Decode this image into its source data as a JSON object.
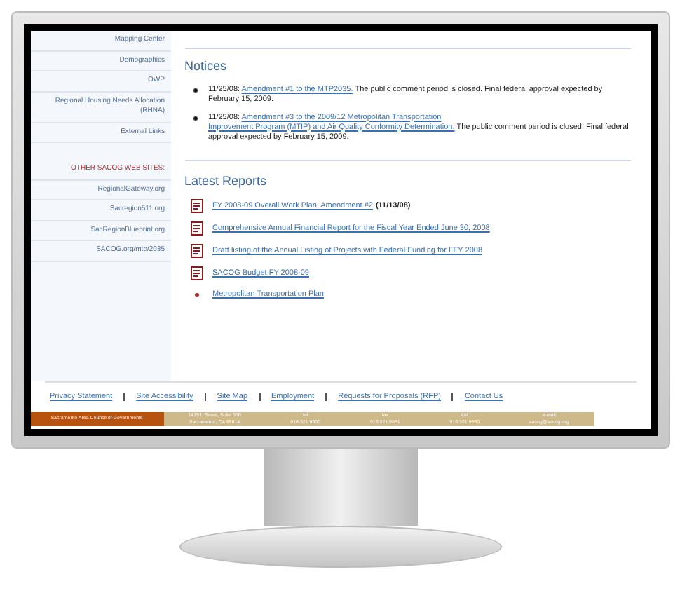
{
  "sidebar": {
    "links": [
      "Mapping Center",
      "Demographics",
      "OWP",
      "Regional Housing Needs Allocation (RHNA)",
      "External Links"
    ],
    "other_sites_heading": "OTHER SACOG WEB SITES:",
    "other_sites": [
      "RegionalGateway.org",
      "Sacregion511.org",
      "SacRegionBlueprint.org",
      "SACOG.org/mtp/2035"
    ]
  },
  "notices": {
    "title": "Notices",
    "items": [
      {
        "date": "11/25/08:",
        "link": "Amendment #1 to the MTP2035.",
        "text": "The public comment period is closed. Final federal approval expected by February 15, 2009."
      },
      {
        "date": "11/25/08:",
        "link_lines": [
          "Amendment #3 to the 2009/12 Metropolitan Transportation",
          "Improvement Program (MTIP) and Air Quality Conformity Determination."
        ],
        "text": "The public comment period is closed. Final federal approval expected by February 15, 2009."
      }
    ]
  },
  "latest_reports": {
    "title": "Latest Reports",
    "items": [
      {
        "kind": "pdf",
        "link": "FY 2008-09 Overall Work Plan, Amendment #2",
        "note": "(11/13/08)"
      },
      {
        "kind": "pdf",
        "link": "Comprehensive Annual Financial Report for the Fiscal Year Ended June 30, 2008"
      },
      {
        "kind": "pdf",
        "link": "Draft listing of the Annual Listing of Projects with Federal Funding for FFY 2008"
      },
      {
        "kind": "pdf",
        "link": "SACOG Budget FY 2008-09"
      },
      {
        "kind": "bullet",
        "link": "Metropolitan Transportation Plan"
      }
    ]
  },
  "footer_links": [
    "Privacy Statement",
    "Site Accessibility",
    "Site Map",
    "Employment",
    "Requests for Proposals (RFP)",
    "Contact Us"
  ],
  "footer_band": {
    "organization": "Sacramento Area Council of Governments",
    "contacts": [
      {
        "label": "1415 L Street, Suite 300",
        "value": "Sacramento, CA 95814"
      },
      {
        "label": "tel",
        "value": "916.321.9000"
      },
      {
        "label": "fax",
        "value": "916.321.9551"
      },
      {
        "label": "tdd",
        "value": "916.321.9550"
      },
      {
        "label": "e-mail",
        "value": "sacog@sacog.org"
      }
    ]
  }
}
